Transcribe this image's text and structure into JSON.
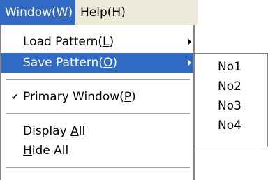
{
  "menubar": {
    "window": {
      "label": "Window(",
      "key": "W",
      "close": ")"
    },
    "help": {
      "label": "Help(",
      "key": "H",
      "close": ")"
    }
  },
  "window_menu": {
    "load_pattern": {
      "label": "Load Pattern(",
      "key": "L",
      "close": ")"
    },
    "save_pattern": {
      "label": "Save Pattern(",
      "key": "O",
      "close": ")"
    },
    "primary_window": {
      "check": "✔",
      "label": "Primary Window(",
      "key": "P",
      "close": ")"
    },
    "display_all": {
      "label": "Display ",
      "key": "A",
      "rest": "ll"
    },
    "hide_all": {
      "key": "H",
      "rest": "ide All"
    }
  },
  "submenu": {
    "items": [
      "No1",
      "No2",
      "No3",
      "No4"
    ]
  },
  "colors": {
    "highlight": "#316ac5",
    "menubar_bg": "#ece9d8",
    "border": "#848484"
  }
}
